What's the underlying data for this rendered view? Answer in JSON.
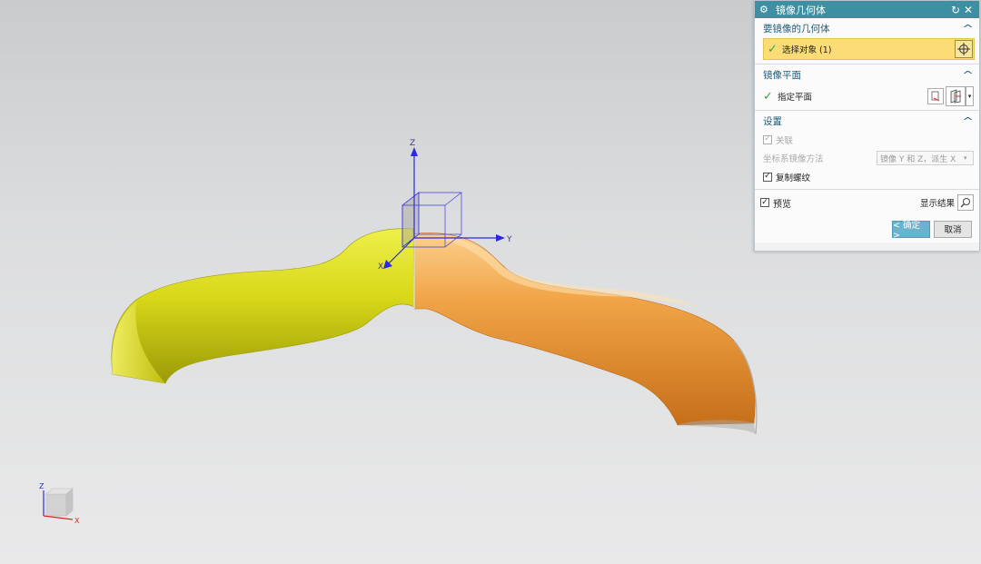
{
  "viewport": {
    "axes": {
      "z": "Z",
      "y": "Y",
      "x": "X"
    },
    "triad": {
      "z": "Z",
      "x": "X"
    },
    "colors": {
      "mirror_source": "#d6d617",
      "mirror_result": "#ec9a3c",
      "axis_blue": "#2a2ae0"
    }
  },
  "dialog": {
    "title": "镜像几何体",
    "reset_icon": "reset-icon",
    "close_icon": "close-icon",
    "geometry_section": {
      "title": "要镜像的几何体",
      "select_label": "选择对象 (1)"
    },
    "plane_section": {
      "title": "镜像平面",
      "specify_label": "指定平面"
    },
    "settings_section": {
      "title": "设置",
      "associative_label": "关联",
      "csys_method_label": "坐标系镜像方法",
      "csys_method_value": "镜像 Y 和 Z，派生 X",
      "copy_threads_label": "复制螺纹"
    },
    "preview_label": "预览",
    "show_result_label": "显示结果",
    "ok_label": "< 确定 >",
    "cancel_label": "取消",
    "accent_color": "#3f8fa3",
    "highlight_color": "#fbdc76"
  }
}
